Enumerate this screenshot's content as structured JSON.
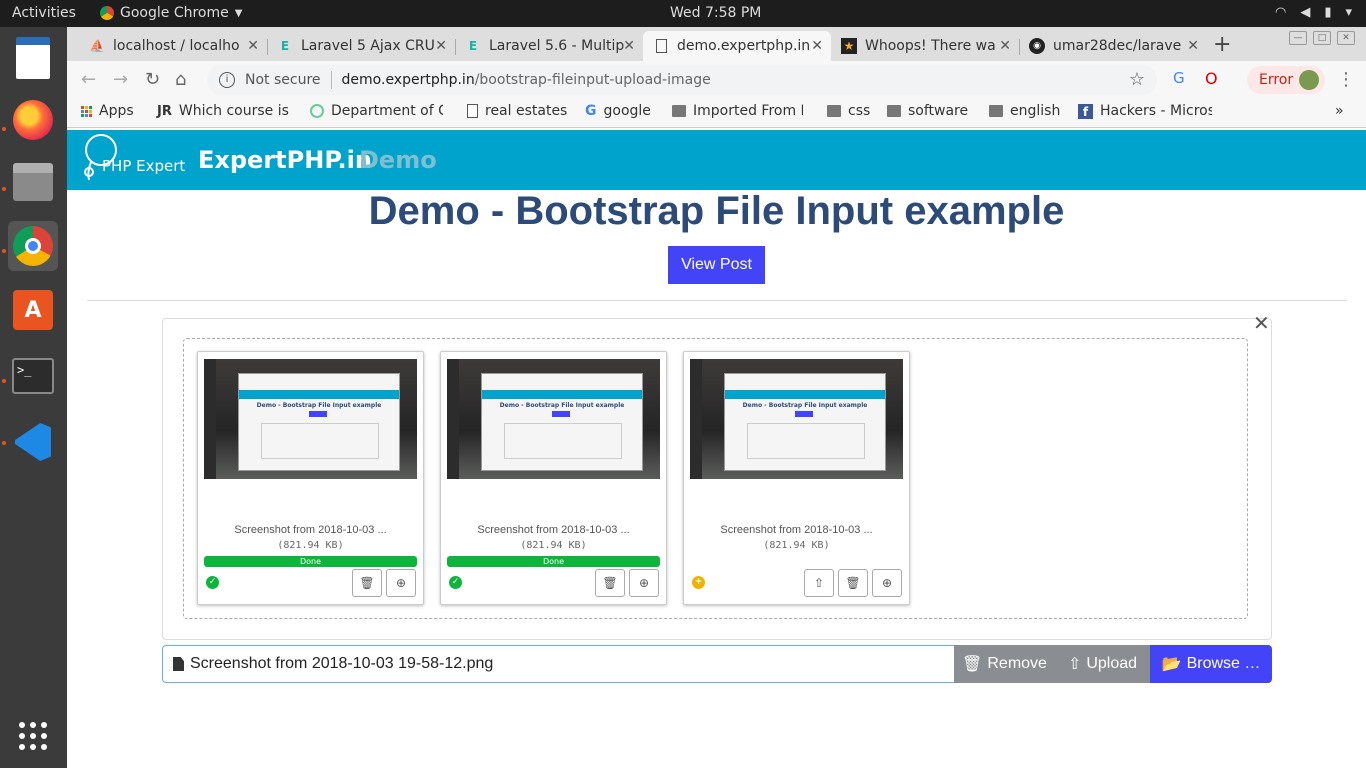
{
  "os": {
    "activities": "Activities",
    "app_name": "Google Chrome",
    "clock": "Wed  7:58 PM"
  },
  "tabs": [
    {
      "title": "localhost / localho",
      "active": false
    },
    {
      "title": "Laravel 5 Ajax CRU",
      "active": false
    },
    {
      "title": "Laravel 5.6 - Multip",
      "active": false
    },
    {
      "title": "demo.expertphp.in",
      "active": true
    },
    {
      "title": "Whoops! There wa",
      "active": false
    },
    {
      "title": "umar28dec/larave",
      "active": false
    }
  ],
  "address": {
    "security": "Not secure",
    "domain": "demo.expertphp.in",
    "path": "/bootstrap-fileinput-upload-image"
  },
  "error_chip": "Error",
  "bookmarks": [
    {
      "label": "Apps"
    },
    {
      "label": "Which course is"
    },
    {
      "label": "Department of C"
    },
    {
      "label": "real estates"
    },
    {
      "label": "google"
    },
    {
      "label": "Imported From F"
    },
    {
      "label": "css"
    },
    {
      "label": "software"
    },
    {
      "label": "english"
    },
    {
      "label": "Hackers - Micros"
    }
  ],
  "site": {
    "logo_text": "PHP Expert",
    "brand": "ExpertPHP.in",
    "demo": "Demo",
    "page_title": "Demo - Bootstrap File Input example",
    "view_post": "View Post"
  },
  "files": [
    {
      "caption": "Screenshot from 2018-10-03 ...",
      "size": "(821.94 KB)",
      "progress": "Done",
      "status": "uploaded"
    },
    {
      "caption": "Screenshot from 2018-10-03 ...",
      "size": "(821.94 KB)",
      "progress": "Done",
      "status": "uploaded"
    },
    {
      "caption": "Screenshot from 2018-10-03 ...",
      "size": "(821.94 KB)",
      "progress": "",
      "status": "pending"
    }
  ],
  "thumb": {
    "title": "Demo - Bootstrap File Input example"
  },
  "file_input": {
    "caption": "Screenshot from 2018-10-03 19-58-12.png",
    "remove": "Remove",
    "upload": "Upload",
    "browse": "Browse …"
  },
  "colors": {
    "header": "#00a3cc",
    "title": "#2d4b78",
    "primary": "#4343f7",
    "success": "#0cb53c",
    "pending": "#f0b400",
    "remove_bg": "#8a8e93",
    "upload_bg": "#8a8e93"
  }
}
